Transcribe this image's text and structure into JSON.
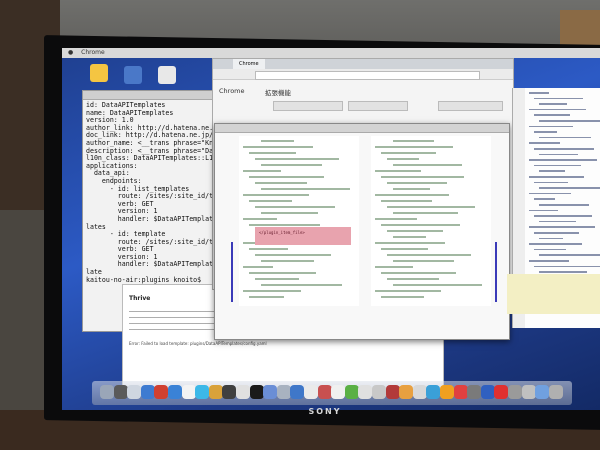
{
  "monitor": {
    "brand": "SONY"
  },
  "menubar": {
    "items": [
      "",
      "Chrome",
      "",
      ""
    ]
  },
  "desktop_icons": [
    {
      "name": "folder-icon",
      "color": "#f4c542"
    },
    {
      "name": "folder-icon",
      "color": "#4a78c8"
    },
    {
      "name": "document-icon",
      "color": "#e8e8e8"
    }
  ],
  "terminal": {
    "lines": [
      "id: DataAPITemplates",
      "name: DataAPITemplates",
      "version: 1.0",
      "author_link: http://d.hatena.ne.jp",
      "doc_link: http://d.hatena.ne.jp/n",
      "author_name: <__trans phrase=\"Kno",
      "description: <__trans phrase=\"Data",
      "l10n_class: DataAPITemplates::L10",
      "applications:",
      "  data_api:",
      "    endpoints:",
      "      - id: list_templates",
      "        route: /sites/:site_id/tem",
      "        verb: GET",
      "        version: 1",
      "        handler: $DataAPITemplates",
      "lates",
      "      - id: template",
      "        route: /sites/:site_id/tem",
      "        verb: GET",
      "        version: 1",
      "        handler: $DataAPITemplates",
      "late",
      "kaitou-no-air:plugins knoito$"
    ]
  },
  "post": {
    "title": "Thrive",
    "error": "Error: Failed to load template: plugins/DataAPITemplates/config.yaml"
  },
  "browser": {
    "tab": "Chrome",
    "heading": "Chrome",
    "heading2": "拡張機能",
    "buttons": [
      "",
      "",
      ""
    ]
  },
  "dialog": {
    "title": "",
    "highlight": "</plugin_item_file>"
  },
  "colors": {
    "desktop": "#2c5ac5",
    "diff_removed": "#e8a3ae",
    "diff_marker": "#3a3ab8"
  },
  "dock_icons": [
    "#9aa6b8",
    "#5a5a5a",
    "#cfd6e0",
    "#3e7bd1",
    "#d04030",
    "#3a82d6",
    "#f3f3f3",
    "#3cb8e8",
    "#d9a23a",
    "#404040",
    "#e0e0e0",
    "#1a1a1a",
    "#6a8ed6",
    "#a8b2c0",
    "#3f77c9",
    "#eaeaea",
    "#c85050",
    "#f0f0f0",
    "#5ab045",
    "#e0e0e0",
    "#c8c8c8",
    "#b23a3a",
    "#e8a040",
    "#d8d8d8",
    "#3aa0d8",
    "#f0a020",
    "#e04040",
    "#7a7a7a",
    "#3060c0",
    "#e03030",
    "#9a9a9a",
    "#c0c0c0",
    "#70a0e0",
    "#b0b0b0"
  ]
}
